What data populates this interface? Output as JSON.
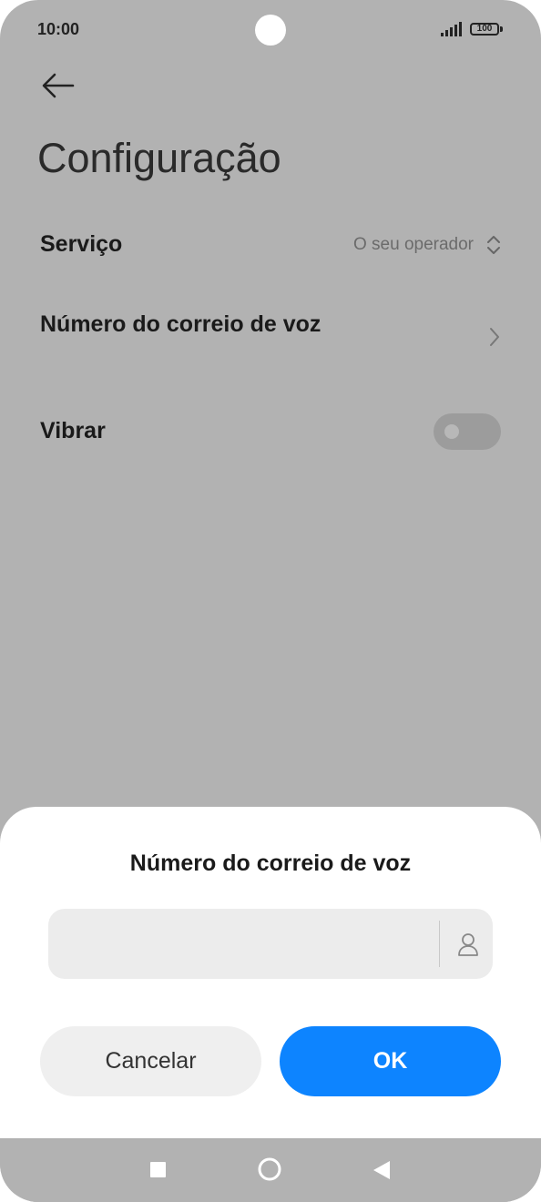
{
  "status_bar": {
    "time": "10:00",
    "battery": "100"
  },
  "page": {
    "title": "Configuração"
  },
  "settings": {
    "service": {
      "label": "Serviço",
      "value": "O seu operador"
    },
    "voicemail_number": {
      "label": "Número do correio de voz"
    },
    "vibrate": {
      "label": "Vibrar",
      "enabled": false
    }
  },
  "dialog": {
    "title": "Número do correio de voz",
    "input": {
      "value": "",
      "placeholder": ""
    },
    "cancel_label": "Cancelar",
    "ok_label": "OK",
    "colors": {
      "ok_button": "#0d84ff"
    }
  },
  "icons": {
    "back": "arrow-left-icon",
    "service_selector": "chevron-up-down-icon",
    "voicemail_chevron": "chevron-right-icon",
    "contact_picker": "person-icon",
    "nav": [
      "square-recents-icon",
      "circle-home-icon",
      "triangle-back-icon"
    ]
  }
}
